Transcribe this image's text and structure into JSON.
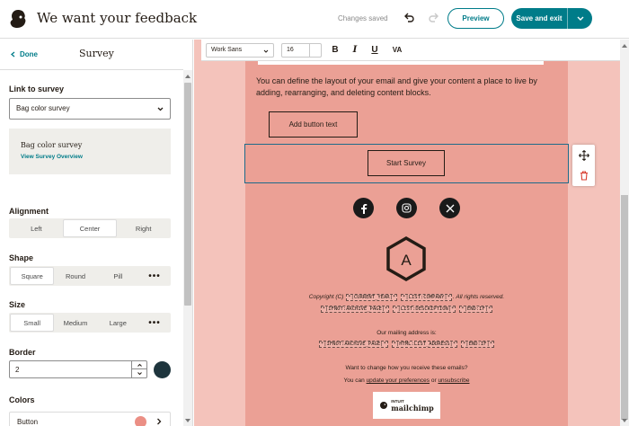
{
  "app": {
    "title": "We want your feedback",
    "status": "Changes saved",
    "preview_label": "Preview",
    "save_label": "Save and exit",
    "accent": "#007c89"
  },
  "panel": {
    "back_label": "Done",
    "title": "Survey",
    "link_label": "Link to survey",
    "survey_select": "Bag color survey",
    "card_title": "Bag color survey",
    "card_link": "View Survey Overview",
    "alignment_label": "Alignment",
    "alignment_options": [
      "Left",
      "Center",
      "Right"
    ],
    "alignment_selected": "Center",
    "shape_label": "Shape",
    "shape_options": [
      "Square",
      "Round",
      "Pill"
    ],
    "shape_selected": "Square",
    "size_label": "Size",
    "size_options": [
      "Small",
      "Medium",
      "Large"
    ],
    "size_selected": "Small",
    "border_label": "Border",
    "border_value": "2",
    "border_color": "#1e353d",
    "colors_label": "Colors",
    "button_color_label": "Button",
    "button_color": "#eb8f85"
  },
  "toolbar": {
    "font": "Work Sans",
    "size": "16",
    "bold": "B",
    "italic": "I",
    "underline": "U",
    "va": "VA"
  },
  "email": {
    "background": "#eba095",
    "outer_background": "#f4c3bb",
    "body_text": "You can define the layout of your email and give your content a place to live by adding, rearranging, and deleting content blocks.",
    "add_button": "Add button text",
    "survey_button": "Start Survey",
    "social_icons": [
      "facebook-icon",
      "instagram-icon",
      "x-icon"
    ],
    "logo_letter": "A",
    "copyright_prefix": "Copyright (C)",
    "current_year": "*|CURRENT_YEAR|*",
    "list_company": "*|LIST:COMPANY|*",
    "rights": ". All rights reserved.",
    "ifnot_archive": "*|IFNOT:ARCHIVE_PAGE|*",
    "list_description": "*|LIST:DESCRIPTION|*",
    "end_if": "*|END:IF|*",
    "mailing_label": "Our mailing address is:",
    "html_list_address": "*|HTML:LIST_ADDRESS|*",
    "change_text": "Want to change how you receive these emails?",
    "update_prefix": "You can",
    "update_link": "update your preferences",
    "or_text": "or",
    "unsubscribe_link": "unsubscribe",
    "badge_small": "INTUIT",
    "badge_big": "mailchimp"
  }
}
